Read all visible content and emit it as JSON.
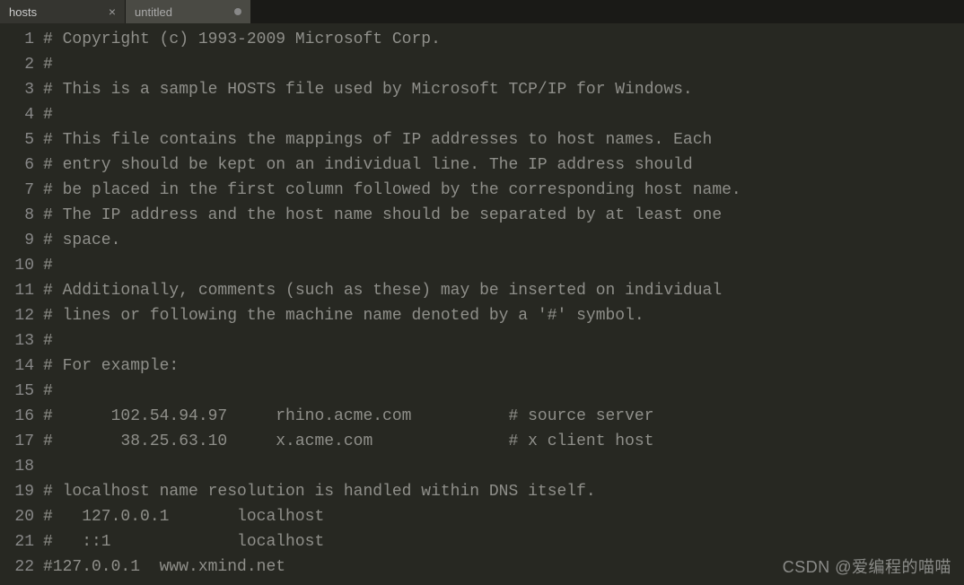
{
  "tabs": [
    {
      "label": "hosts",
      "active": true,
      "modified": false
    },
    {
      "label": "untitled",
      "active": false,
      "modified": true
    }
  ],
  "lines": [
    "# Copyright (c) 1993-2009 Microsoft Corp.",
    "#",
    "# This is a sample HOSTS file used by Microsoft TCP/IP for Windows.",
    "#",
    "# This file contains the mappings of IP addresses to host names. Each",
    "# entry should be kept on an individual line. The IP address should",
    "# be placed in the first column followed by the corresponding host name.",
    "# The IP address and the host name should be separated by at least one",
    "# space.",
    "#",
    "# Additionally, comments (such as these) may be inserted on individual",
    "# lines or following the machine name denoted by a '#' symbol.",
    "#",
    "# For example:",
    "#",
    "#      102.54.94.97     rhino.acme.com          # source server",
    "#       38.25.63.10     x.acme.com              # x client host",
    "",
    "# localhost name resolution is handled within DNS itself.",
    "#   127.0.0.1       localhost",
    "#   ::1             localhost",
    "#127.0.0.1  www.xmind.net"
  ],
  "watermark": "CSDN @爱编程的喵喵"
}
